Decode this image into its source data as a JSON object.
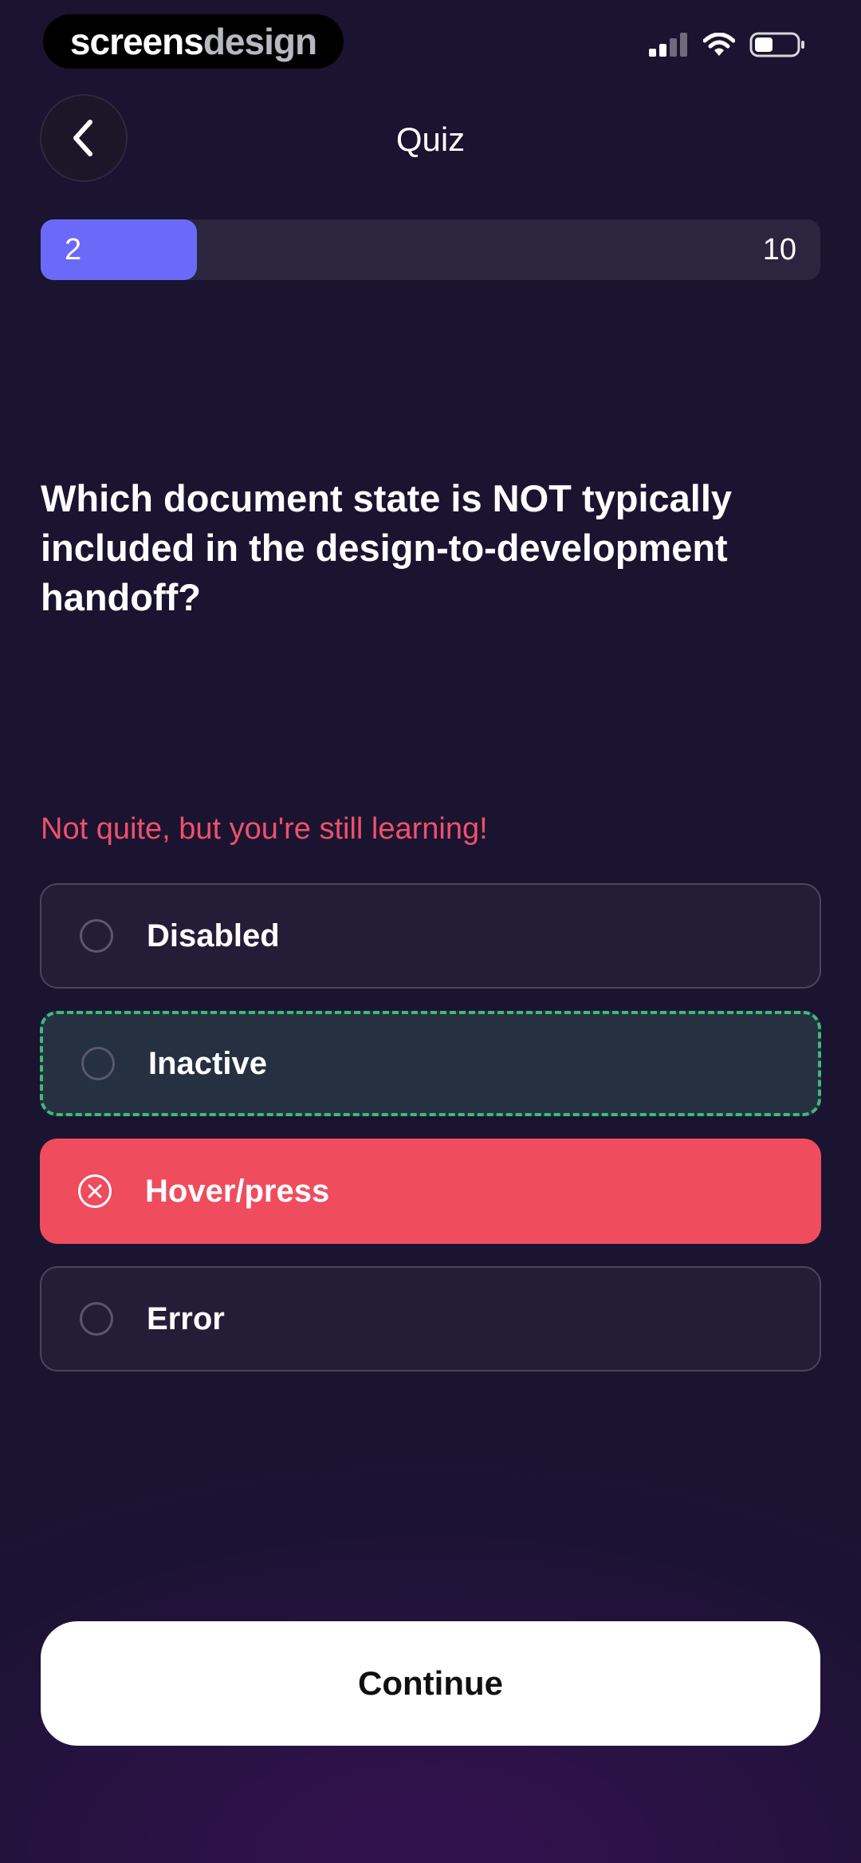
{
  "status_bar": {
    "brand_part1": "screens",
    "brand_part2": "design",
    "icons": [
      "cellular-signal-icon",
      "wifi-icon",
      "battery-icon"
    ]
  },
  "header": {
    "title": "Quiz",
    "back_icon": "chevron-left-icon"
  },
  "progress": {
    "current": "2",
    "total": "10",
    "fill_fraction": 0.2
  },
  "question": {
    "text": "Which document state is NOT typically included in the design-to-development handoff?"
  },
  "feedback": {
    "text": "Not quite, but you're still learning!"
  },
  "options": [
    {
      "label": "Disabled",
      "state": "default"
    },
    {
      "label": "Inactive",
      "state": "correct"
    },
    {
      "label": "Hover/press",
      "state": "wrong"
    },
    {
      "label": "Error",
      "state": "default"
    }
  ],
  "continue_button": {
    "label": "Continue"
  },
  "colors": {
    "accent": "#6b6af8",
    "wrong": "#ef4c5e",
    "correct_border": "#3fb978",
    "feedback_text": "#f0506a"
  }
}
